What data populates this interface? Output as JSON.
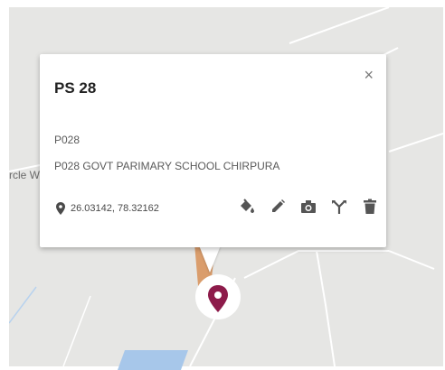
{
  "map": {
    "partial_label": "rcle W"
  },
  "popup": {
    "title": "PS 28",
    "close_glyph": "×",
    "code": "P028",
    "name": "P028 GOVT PARIMARY SCHOOL CHIRPURA",
    "coordinates": "26.03142, 78.32162"
  },
  "toolbar": {
    "icons": [
      "paint-bucket-icon",
      "pencil-icon",
      "camera-icon",
      "split-icon",
      "trash-icon"
    ]
  },
  "colors": {
    "marker": "#8d1b4a",
    "water": "#a7c7ea",
    "map_bg": "#e6e6e4"
  }
}
